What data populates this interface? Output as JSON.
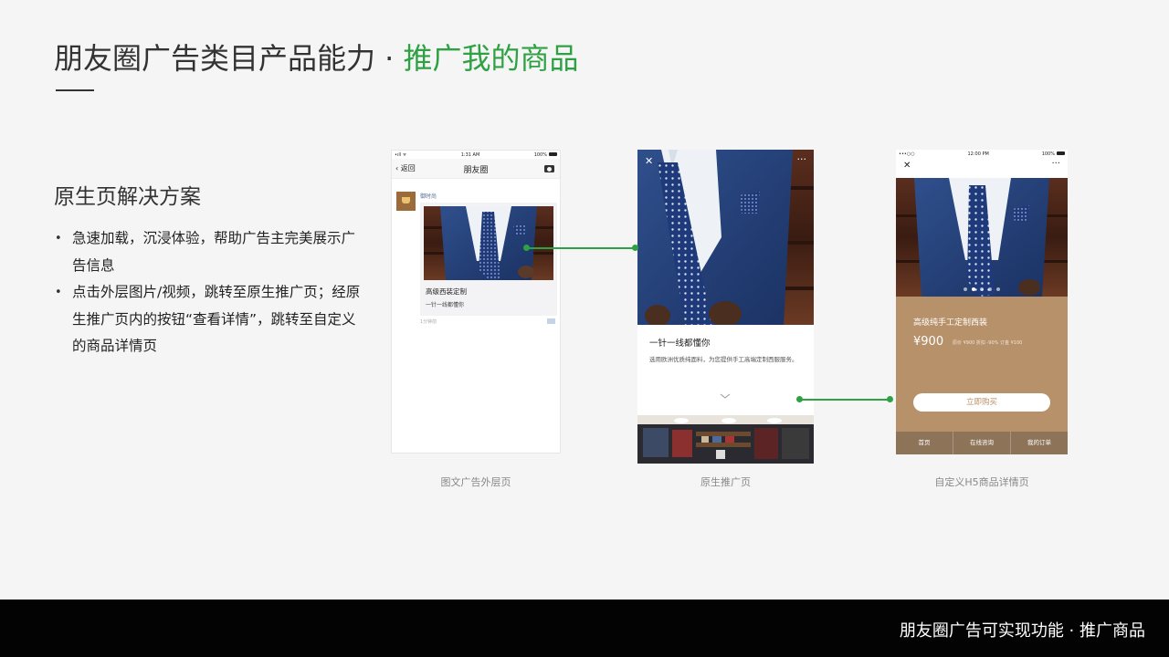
{
  "header": {
    "title_main": "朋友圈广告类目产品能力 · ",
    "title_accent": "推广我的商品"
  },
  "section": {
    "heading": "原生页解决方案",
    "bullets": [
      "急速加载，沉浸体验，帮助广告主完美展示广告信息",
      "点击外层图片/视频，跳转至原生推广页；经原生推广页内的按钮“查看详情”，跳转至自定义的商品详情页"
    ]
  },
  "phone_feed": {
    "status_left": "•ıll ᯤ",
    "status_time": "1:31 AM",
    "status_right": "100%",
    "back_label": "返回",
    "nav_title": "朋友圈",
    "camera_icon": "camera-icon",
    "user_name": "御时尚",
    "card_title": "高级西装定制",
    "card_subtitle": "一针一线都懂你",
    "time_text": "1分钟前",
    "caption": "图文广告外层页"
  },
  "phone_native": {
    "close_symbol": "✕",
    "more_symbol": "···",
    "heading": "一针一线都懂你",
    "description": "选用欧洲优质纯面料，为您提供手工高端定制西服服务。",
    "chevron_icon": "chevron-down-icon",
    "caption": "原生推广页"
  },
  "phone_h5": {
    "status_left": "•••○○",
    "status_time": "12:00 PM",
    "status_right": "100%",
    "close_symbol": "✕",
    "more_symbol": "···",
    "product_name": "高级纯手工定制西装",
    "price": "¥900",
    "meta": "原价 ¥900   折扣 -90%   订金 ¥100",
    "buy_label": "立即购买",
    "tabs": [
      "首页",
      "在线咨询",
      "我的订单"
    ],
    "caption": "自定义H5商品详情页"
  },
  "footer": {
    "text": "朋友圈广告可实现功能 · 推广商品"
  },
  "colors": {
    "accent": "#2ea143",
    "background": "#f5f5f5",
    "footer_bg": "#030303",
    "h5_brown": "#b7916a"
  }
}
